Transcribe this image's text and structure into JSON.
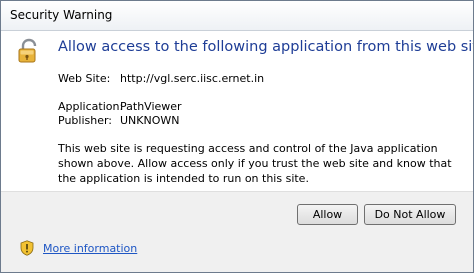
{
  "window": {
    "title": "Security Warning"
  },
  "dialog": {
    "heading": "Allow access to the following application from this web site?",
    "website_label": "Web Site:",
    "website_value": "http://vgl.serc.iisc.ernet.in",
    "application_label": "Application:",
    "application_value": "PathViewer",
    "publisher_label": "Publisher:",
    "publisher_value": "UNKNOWN",
    "description": "This web site is requesting access and control of the Java application shown above. Allow access only if you trust the web site and know that the application is intended to run on this site."
  },
  "buttons": {
    "allow": "Allow",
    "deny": "Do Not Allow"
  },
  "footer": {
    "more_info": "More information"
  },
  "icons": {
    "lock": "unlocked-padlock-icon",
    "shield": "warning-shield-icon"
  },
  "colors": {
    "heading": "#1e3d96",
    "link": "#1e56c4",
    "lock_body": "#e8b33a",
    "shield": "#f2c233"
  }
}
